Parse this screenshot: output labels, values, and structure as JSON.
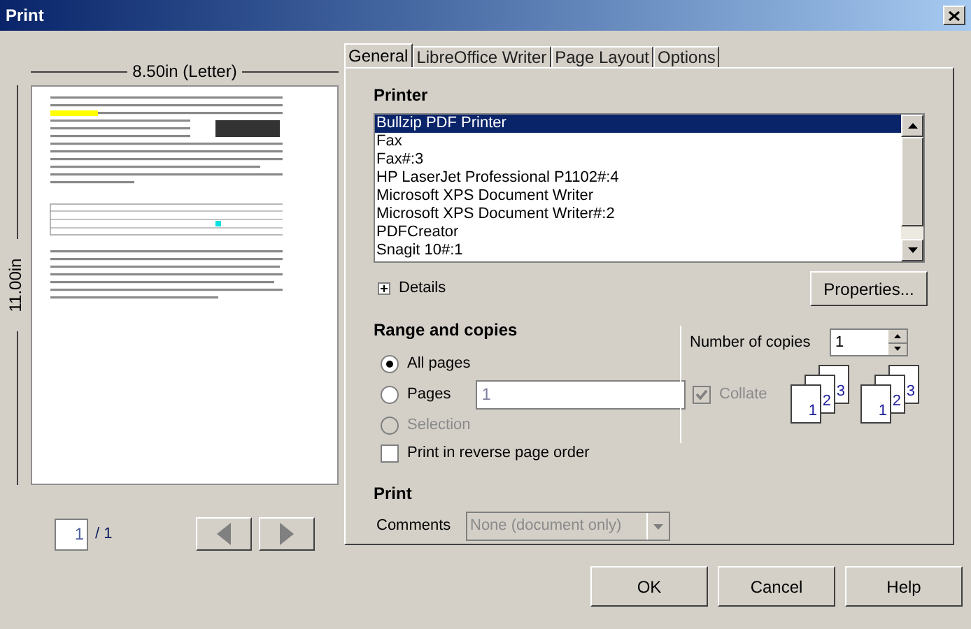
{
  "window": {
    "title": "Print"
  },
  "preview": {
    "width_label": "8.50in (Letter)",
    "height_label": "11.00in",
    "page_value": "1",
    "page_total": "/ 1"
  },
  "tabs": [
    {
      "label": "General",
      "selected": true
    },
    {
      "label": "LibreOffice Writer",
      "selected": false
    },
    {
      "label": "Page Layout",
      "selected": false
    },
    {
      "label": "Options",
      "selected": false
    }
  ],
  "printer": {
    "heading": "Printer",
    "items": [
      {
        "name": "Bullzip PDF Printer",
        "selected": true
      },
      {
        "name": "Fax",
        "selected": false
      },
      {
        "name": "Fax#:3",
        "selected": false
      },
      {
        "name": "HP LaserJet Professional P1102#:4",
        "selected": false
      },
      {
        "name": "Microsoft XPS Document Writer",
        "selected": false
      },
      {
        "name": "Microsoft XPS Document Writer#:2",
        "selected": false
      },
      {
        "name": "PDFCreator",
        "selected": false
      },
      {
        "name": "Snagit 10#:1",
        "selected": false
      }
    ],
    "details": {
      "label": "Details",
      "expanded": false
    },
    "properties": "Properties..."
  },
  "range": {
    "heading": "Range and copies",
    "options": [
      {
        "kind": "radio",
        "label": "All pages",
        "selected": true,
        "disabled": false
      },
      {
        "kind": "radio-field",
        "label": "Pages",
        "selected": false,
        "disabled": false,
        "value": "1"
      },
      {
        "kind": "radio",
        "label": "Selection",
        "selected": false,
        "disabled": true
      }
    ],
    "reverse": {
      "label": "Print in reverse page order",
      "checked": false
    }
  },
  "copies": {
    "label": "Number of copies",
    "value": "1",
    "collate": {
      "label": "Collate",
      "checked": true,
      "disabled": true
    },
    "collate_icons": [
      [
        "1",
        "2",
        "3"
      ],
      [
        "1",
        "2",
        "3"
      ]
    ]
  },
  "print": {
    "heading": "Print",
    "comments_label": "Comments",
    "comments_value": "None (document only)",
    "disabled": true
  },
  "buttons": [
    "OK",
    "Cancel",
    "Help"
  ]
}
